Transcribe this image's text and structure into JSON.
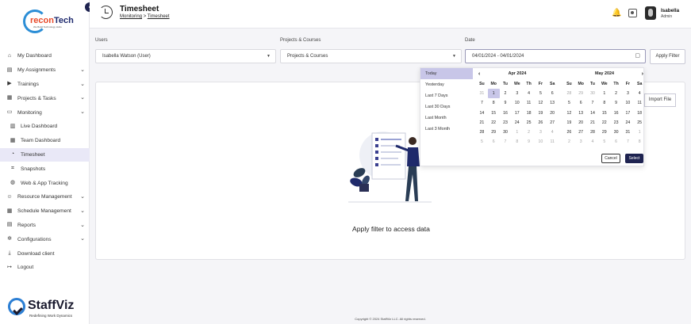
{
  "brand": {
    "logo_top_text": "recon",
    "logo_top_o": "Tech",
    "logo_tagline": "We Build Technology Hubs",
    "bottom_name": "StaffViz",
    "bottom_tagline": "Redefining Work Dynamics"
  },
  "sidebar": {
    "items": [
      {
        "label": "My Dashboard",
        "icon": "home-icon"
      },
      {
        "label": "My Assignments",
        "icon": "clipboard-icon",
        "chevron": true
      },
      {
        "label": "Trainings",
        "icon": "play-icon",
        "chevron": true
      },
      {
        "label": "Projects & Tasks",
        "icon": "folder-icon",
        "chevron": true
      },
      {
        "label": "Monitoring",
        "icon": "monitor-icon",
        "chevron": true
      },
      {
        "label": "Live Dashboard",
        "icon": "bar-chart-icon",
        "sub": true
      },
      {
        "label": "Team Dashboard",
        "icon": "grid-icon",
        "sub": true
      },
      {
        "label": "Timesheet",
        "icon": "clock-icon",
        "sub": true,
        "active": true
      },
      {
        "label": "Snapshots",
        "icon": "frame-icon",
        "sub": true
      },
      {
        "label": "Web & App Tracking",
        "icon": "globe-icon",
        "sub": true
      },
      {
        "label": "Resource Management",
        "icon": "users-icon",
        "chevron": true
      },
      {
        "label": "Schedule Management",
        "icon": "calendar-icon",
        "chevron": true
      },
      {
        "label": "Reports",
        "icon": "report-icon",
        "chevron": true
      },
      {
        "label": "Configurations",
        "icon": "gear-icon",
        "chevron": true
      },
      {
        "label": "Download client",
        "icon": "download-icon"
      },
      {
        "label": "Logout",
        "icon": "logout-icon"
      }
    ]
  },
  "header": {
    "title": "Timesheet",
    "crumb_parent": "Monitoring",
    "crumb_sep": ">",
    "crumb_current": "Timesheet",
    "user_name": "Isabella",
    "user_role": "Admin"
  },
  "filters": {
    "users_label": "Users",
    "users_value": "Isabella Watson (User)",
    "projects_label": "Projects & Courses",
    "projects_value": "Projects & Courses",
    "date_label": "Date",
    "date_value": "04/01/2024 - 04/01/2024",
    "apply_label": "Apply Filter"
  },
  "main": {
    "empty_text": "Apply filter to access data",
    "import_label": "Import File"
  },
  "datepicker": {
    "presets": [
      "Today",
      "Yesterday",
      "Last 7 Days",
      "Last 30 Days",
      "Last Month",
      "Last 3 Month"
    ],
    "selected_preset": "Today",
    "weekdays": [
      "Su",
      "Mo",
      "Tu",
      "We",
      "Th",
      "Fr",
      "Sa"
    ],
    "left_month": "Apr 2024",
    "right_month": "May 2024",
    "left_days": [
      "31",
      "1",
      "2",
      "3",
      "4",
      "5",
      "6",
      "7",
      "8",
      "9",
      "10",
      "11",
      "12",
      "13",
      "14",
      "15",
      "16",
      "17",
      "18",
      "19",
      "20",
      "21",
      "22",
      "23",
      "24",
      "25",
      "26",
      "27",
      "28",
      "29",
      "30",
      "1",
      "2",
      "3",
      "4",
      "5",
      "6",
      "7",
      "8",
      "9",
      "10",
      "11"
    ],
    "right_days": [
      "28",
      "29",
      "30",
      "1",
      "2",
      "3",
      "4",
      "5",
      "6",
      "7",
      "8",
      "9",
      "10",
      "11",
      "12",
      "13",
      "14",
      "15",
      "16",
      "17",
      "18",
      "19",
      "20",
      "21",
      "22",
      "23",
      "24",
      "25",
      "26",
      "27",
      "28",
      "29",
      "30",
      "31",
      "1",
      "2",
      "3",
      "4",
      "5",
      "6",
      "7",
      "8"
    ],
    "cancel_label": "Cancel",
    "select_label": "Select"
  },
  "footer": {
    "copyright": "Copyright © 2024 StaffViz LLC. All rights reserved."
  }
}
